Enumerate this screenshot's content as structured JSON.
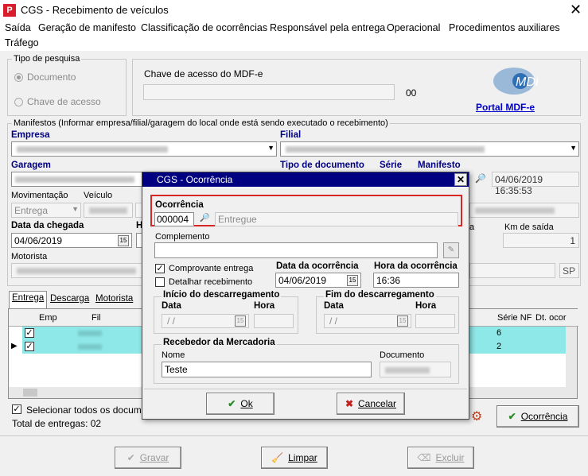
{
  "window": {
    "title": "CGS - Recebimento de veículos",
    "app_icon": "P"
  },
  "menu": [
    "Saída",
    "Geração de manifesto",
    "Classificação de ocorrências",
    "Responsável pela entrega",
    "Operacional",
    "Procedimentos auxiliares",
    "Tráfego"
  ],
  "tipo_pesquisa": {
    "label": "Tipo de pesquisa",
    "opt1": "Documento",
    "opt2": "Chave de acesso"
  },
  "chave": {
    "label": "Chave de acesso do MDF-e",
    "count": "00",
    "portal_link": "Portal MDF-e",
    "logo_text": "MDF e"
  },
  "manifestos": {
    "group_label": "Manifestos (Informar empresa/filial/garagem do local onde está sendo executado o recebimento)",
    "empresa_label": "Empresa",
    "filial_label": "Filial",
    "garagem_label": "Garagem",
    "tipo_doc_label": "Tipo de documento",
    "serie_label": "Série",
    "manifesto_label": "Manifesto",
    "datetime": "04/06/2019 16:35:53",
    "movimentacao_label": "Movimentação",
    "movimentacao_value": "Entrega",
    "veiculo_label": "Veículo",
    "data_chegada_label": "Data da chegada",
    "hora_prefix": "H",
    "data_chegada_value": "04/06/2019",
    "km_saida_label": "Km de saída",
    "km_saida_value": "1",
    "km_partial_label": "a",
    "motorista_label": "Motorista",
    "uf": "SP"
  },
  "tabs": [
    "Entrega",
    "Descarga",
    "Motorista"
  ],
  "grid": {
    "headers": [
      "Emp",
      "Fil"
    ],
    "right_headers": [
      "Série NF",
      "Dt. ocor"
    ],
    "rows": [
      {
        "serie": "6"
      },
      {
        "serie": "2"
      }
    ]
  },
  "footer": {
    "select_all": "Selecionar todos os documento",
    "total": "Total de entregas: 02",
    "ocorrencia_btn": "Ocorrência",
    "gravar": "Gravar",
    "limpar": "Limpar",
    "excluir": "Excluir"
  },
  "dialog": {
    "title": "CGS - Ocorrência",
    "ocorrencia_label": "Ocorrência",
    "ocorrencia_code": "000004",
    "ocorrencia_desc": "Entregue",
    "complemento_label": "Complemento",
    "comprovante_label": "Comprovante entrega",
    "detalhar_label": "Detalhar recebimento",
    "data_ocorrencia_label": "Data da ocorrência",
    "data_ocorrencia_value": "04/06/2019",
    "hora_ocorrencia_label": "Hora da ocorrência",
    "hora_ocorrencia_value": "16:36",
    "inicio_label": "Início do descarregamento",
    "fim_label": "Fim do descarregamento",
    "data_label": "Data",
    "hora_label": "Hora",
    "date_placeholder": "/ /",
    "recebedor_label": "Recebedor da Mercadoria",
    "nome_label": "Nome",
    "nome_value": "Teste",
    "documento_label": "Documento",
    "ok": "Ok",
    "cancelar": "Cancelar"
  }
}
